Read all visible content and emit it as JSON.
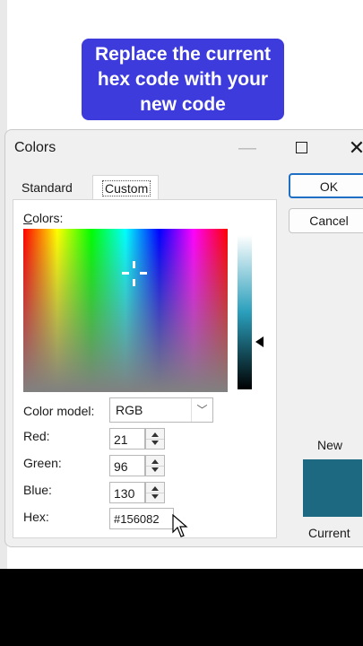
{
  "caption": {
    "line1": "Replace the current",
    "line2": "hex code with your",
    "line3": "new code",
    "background_color": "#3d3bdc"
  },
  "dialog": {
    "title": "Colors",
    "window_controls": [
      "minimize-icon",
      "maximize-icon",
      "close-icon"
    ],
    "tabs": [
      {
        "label": "Standard",
        "selected": false
      },
      {
        "label": "Custom",
        "selected": true
      }
    ],
    "colors_label": "Colors:",
    "color_model": {
      "label": "Color model:",
      "value": "RGB"
    },
    "red": {
      "label": "Red:",
      "value": "21"
    },
    "green": {
      "label": "Green:",
      "value": "96"
    },
    "blue": {
      "label": "Blue:",
      "value": "130"
    },
    "hex": {
      "label": "Hex:",
      "value": "#156082"
    },
    "ok_label": "OK",
    "cancel_label": "Cancel",
    "new_label": "New",
    "current_label": "Current",
    "current_color": "#1e6982",
    "accent_color": "#1f6fc4"
  }
}
